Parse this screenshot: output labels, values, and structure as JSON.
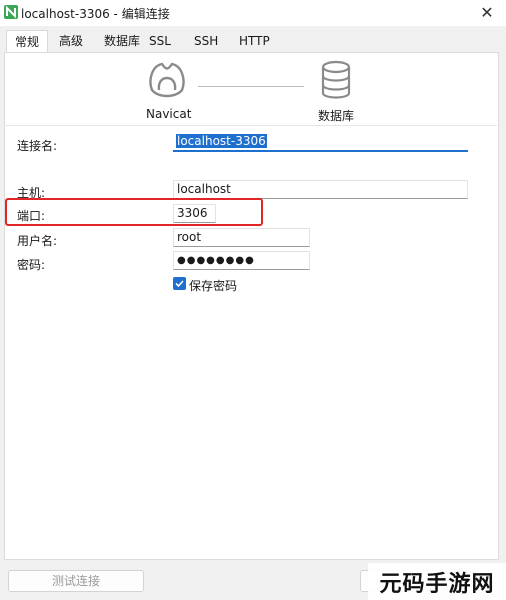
{
  "window": {
    "title": "localhost-3306 - 编辑连接",
    "close_glyph": "✕",
    "app_icon": "navicat-app-icon"
  },
  "tabs": [
    {
      "label": "常规",
      "active": true
    },
    {
      "label": "高级"
    },
    {
      "label": "数据库"
    },
    {
      "label": "SSL"
    },
    {
      "label": "SSH"
    },
    {
      "label": "HTTP"
    }
  ],
  "diagram": {
    "client_label": "Navicat",
    "client_icon": "navicat-icon",
    "server_label": "数据库",
    "server_icon": "database-icon"
  },
  "form": {
    "connection_name": {
      "label": "连接名:",
      "value": "localhost-3306"
    },
    "host": {
      "label": "主机:",
      "value": "localhost"
    },
    "port": {
      "label": "端口:",
      "value": "3306"
    },
    "username": {
      "label": "用户名:",
      "value": "root"
    },
    "password": {
      "label": "密码:",
      "value": "●●●●●●●●"
    },
    "save_password": {
      "label": "保存密码",
      "checked": true
    }
  },
  "buttons": {
    "test_connection": "测试连接"
  },
  "watermark": "元码手游网",
  "colors": {
    "accent": "#1f6fce",
    "highlight": "#e02626",
    "navicat_green": "#4caf50"
  }
}
